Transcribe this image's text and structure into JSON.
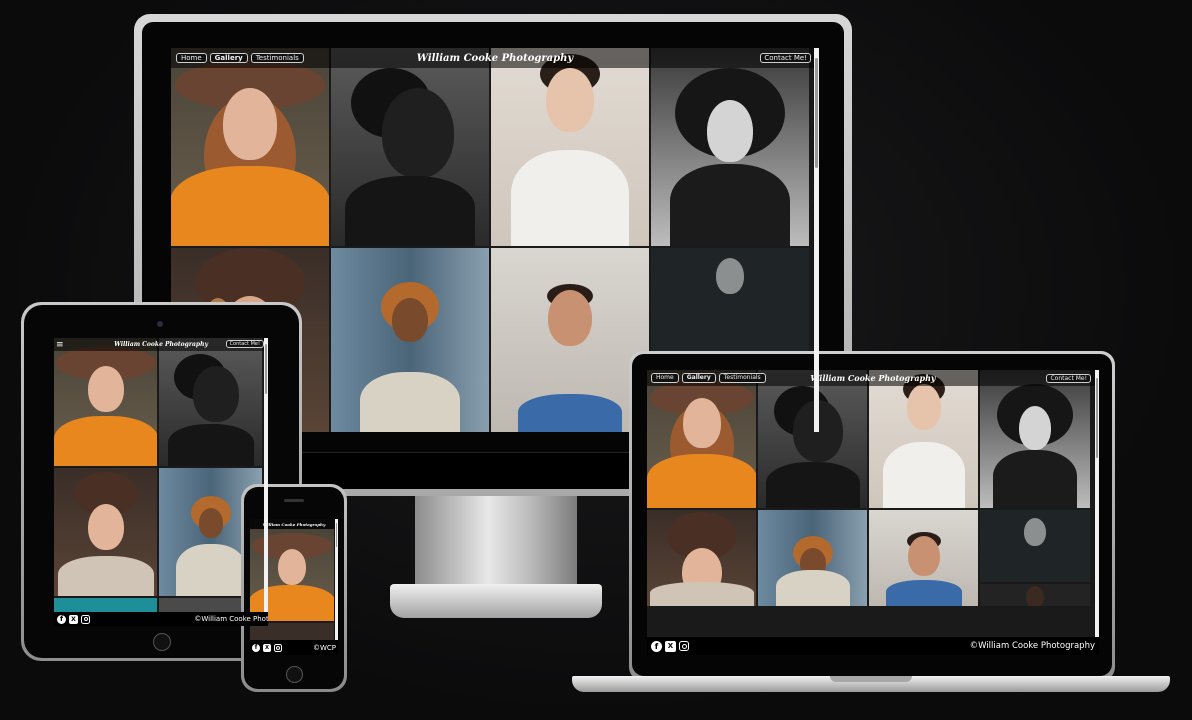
{
  "site": {
    "brand": "William Cooke Photography",
    "nav": [
      "Home",
      "Gallery",
      "Testimonials"
    ],
    "active_nav": "Gallery",
    "contact_label": "Contact Me!",
    "footer_full": "©William Cooke Photography",
    "footer_tablet": "©William Cooke Photo",
    "footer_short": "©WCP",
    "menu_glyph": "≡",
    "social_icons": [
      "facebook-icon",
      "x-twitter-icon",
      "instagram-icon"
    ],
    "social_glyphs": {
      "facebook": "f",
      "x": "X"
    }
  },
  "colors": {
    "background": "#0b0b0c",
    "header_bar": "#000000",
    "footer_bar": "#000000",
    "accent_orange": "#e8871e",
    "text": "#ffffff"
  }
}
